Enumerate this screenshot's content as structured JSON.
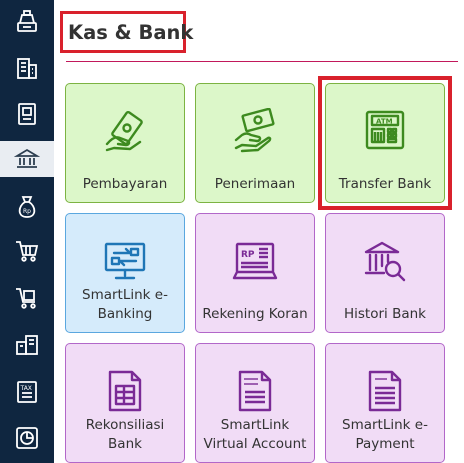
{
  "page": {
    "title": "Kas & Bank"
  },
  "sidebar": {
    "items": [
      {
        "icon": "cash-register-icon"
      },
      {
        "icon": "building-icon"
      },
      {
        "icon": "ledger-book-icon"
      },
      {
        "icon": "bank-icon",
        "active": true
      },
      {
        "icon": "money-bag-icon"
      },
      {
        "icon": "shopping-cart-icon"
      },
      {
        "icon": "cart-box-icon"
      },
      {
        "icon": "warehouse-icon"
      },
      {
        "icon": "tax-icon"
      },
      {
        "icon": "pie-chart-icon"
      }
    ]
  },
  "tiles": [
    {
      "label": "Pembayaran",
      "icon": "payment-hand-icon",
      "color": "#dcf7c9"
    },
    {
      "label": "Penerimaan",
      "icon": "receive-money-icon",
      "color": "#dcf7c9"
    },
    {
      "label": "Transfer Bank",
      "icon": "atm-icon",
      "color": "#dcf7c9"
    },
    {
      "label": "SmartLink e-\nBanking",
      "icon": "computer-transfer-icon",
      "color": "#d5ebfb"
    },
    {
      "label": "Rekening Koran",
      "icon": "bank-statement-icon",
      "color": "#f1dcf6"
    },
    {
      "label": "Histori Bank",
      "icon": "bank-search-icon",
      "color": "#f1dcf6"
    },
    {
      "label": "Rekonsiliasi\nBank",
      "icon": "reconciliation-document-icon",
      "color": "#f1dcf6"
    },
    {
      "label": "SmartLink\nVirtual Account",
      "icon": "virtual-account-document-icon",
      "color": "#f1dcf6"
    },
    {
      "label": "SmartLink e-\nPayment",
      "icon": "epayment-document-icon",
      "color": "#f1dcf6"
    }
  ],
  "colors": {
    "sidebar": "#0f2640",
    "accent_red": "#d9212c",
    "divider": "#c2185b",
    "icon_green": "#3d8a1f",
    "icon_blue": "#1f76b6",
    "icon_purple": "#7a2a96"
  }
}
